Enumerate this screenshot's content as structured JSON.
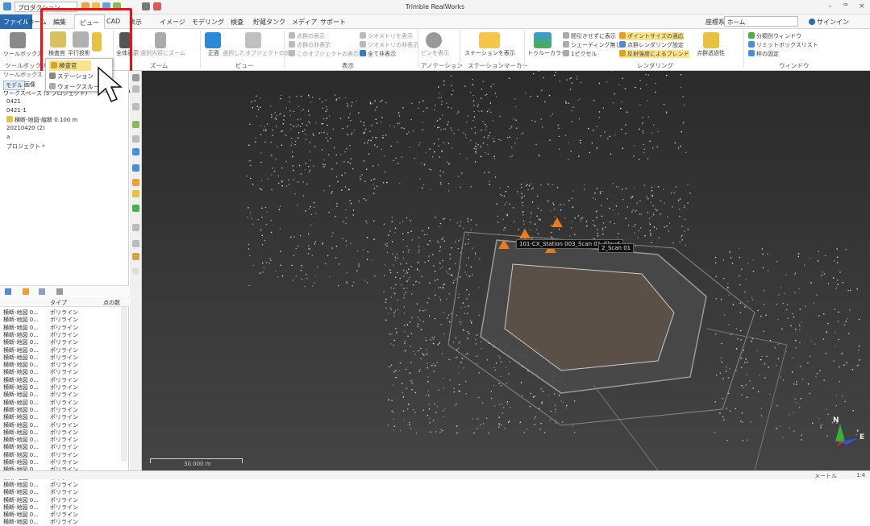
{
  "window": {
    "title": "Trimble RealWorks",
    "quick_select": "プロダクション",
    "controls": [
      "–",
      "ꟹ",
      "×"
    ]
  },
  "menu": {
    "tabs": [
      "ファイル",
      "ホーム",
      "編集",
      "ビュー",
      "CAD",
      "表示",
      "イメージ",
      "モデリング",
      "検査",
      "貯蔵タンク",
      "メディア",
      "サポート"
    ],
    "right_label": "座標系",
    "coord_value": "ホーム",
    "signin": "サインイン"
  },
  "ribbon": {
    "groups": {
      "toolbox": "ツールボックス",
      "zoom": "ズーム",
      "view": "ビュー",
      "display": "表示",
      "annotation": "アノテーション",
      "station_marker": "ステーションマーカー",
      "rendering": "レンダリング",
      "window": "ウィンドウ"
    },
    "toolbox_btn": "ツールボックス",
    "inspector_btn": "検査官",
    "parallel_btn": "平行投影",
    "zoom_all": "全体表示",
    "zoom_selected": "選択内容にズーム",
    "front_view": "正面",
    "selected_view": "選択したオブジェクトの前",
    "display_items": [
      "点群の表示",
      "点群の非表示",
      "このオブジェクトの表示",
      "ジオメトリを表示",
      "ジオメトリの非表示",
      "全て非表示"
    ],
    "pin_btn": "ピンを表示",
    "station_btn": "ステーションを表示",
    "tolerance_btn": "トゥルーカラー",
    "render_items": [
      "間引きせずに表示",
      "シェーディング無し",
      "1ピクセル",
      "ポイントサイズの適応",
      "点群レンダリング設定",
      "反射強度によるブレンド"
    ],
    "transparency_btn": "点群透過性",
    "window_items": [
      "分類別ウィンドウ",
      "リミットボックスリスト",
      "枠の固定"
    ]
  },
  "dropdown": {
    "items": [
      "検査官",
      "ステーション",
      "ウォークスルー"
    ]
  },
  "left_panel": {
    "header": "ツールボックス",
    "workspace_label": "ワークスペース",
    "tabs": [
      "モデル",
      "画像"
    ],
    "tree": [
      "ワークスペース (5 プロジェクト)",
      "0421",
      "0421-1",
      "横断-地図-縦断 0.100 m",
      "20210420 (2)",
      "a",
      "プロジェクト *"
    ],
    "table_headers": [
      "タイプ",
      "点の数"
    ],
    "rows": [
      {
        "name": "横断-地図 0...",
        "type": "ポリライン"
      },
      {
        "name": "横断-地図 0...",
        "type": "ポリライン"
      },
      {
        "name": "横断-地図 0...",
        "type": "ポリライン"
      },
      {
        "name": "横断-地図 0...",
        "type": "ポリライン"
      },
      {
        "name": "横断-地図 0...",
        "type": "ポリライン"
      },
      {
        "name": "横断-地図 0...",
        "type": "ポリライン"
      },
      {
        "name": "横断-地図 0...",
        "type": "ポリライン"
      },
      {
        "name": "横断-地図 0...",
        "type": "ポリライン"
      },
      {
        "name": "横断-地図 0...",
        "type": "ポリライン"
      },
      {
        "name": "横断-地図 0...",
        "type": "ポリライン"
      },
      {
        "name": "横断-地図 0...",
        "type": "ポリライン"
      },
      {
        "name": "横断-地図 0...",
        "type": "ポリライン"
      },
      {
        "name": "横断-地図 0...",
        "type": "ポリライン"
      },
      {
        "name": "横断-地図 0...",
        "type": "ポリライン"
      },
      {
        "name": "横断-地図 0...",
        "type": "ポリライン"
      },
      {
        "name": "横断-地図 0...",
        "type": "ポリライン"
      },
      {
        "name": "横断-地図 0...",
        "type": "ポリライン"
      },
      {
        "name": "横断-地図 0...",
        "type": "ポリライン"
      },
      {
        "name": "横断-地図 0...",
        "type": "ポリライン"
      },
      {
        "name": "横断-地図 0...",
        "type": "ポリライン"
      },
      {
        "name": "横断-地図 0...",
        "type": "ポリライン"
      },
      {
        "name": "横断-地図 0...",
        "type": "ポリライン"
      },
      {
        "name": "横断-地図 0...",
        "type": "ポリライン"
      },
      {
        "name": "横断-地図 0...",
        "type": "ポリライン"
      },
      {
        "name": "横断-地図 0...",
        "type": "ポリライン"
      },
      {
        "name": "横断-地図 0...",
        "type": "ポリライン"
      },
      {
        "name": "横断-地図 0...",
        "type": "ポリライン"
      },
      {
        "name": "横断-地図 0...",
        "type": "ポリライン"
      },
      {
        "name": "横断-地図 0...",
        "type": "ポリライン"
      }
    ]
  },
  "viewport": {
    "scan_label_1": "101-CX_Station 003_Scan 01_Cloud",
    "scan_label_2": "2_Scan 01",
    "scale_label": "30.000 m",
    "compass_n": "N",
    "compass_e": "E"
  },
  "status": {
    "unit": "メートル",
    "right": "1:4"
  },
  "colors": {
    "accent": "#2b6cb0",
    "highlight": "#e11111",
    "warn": "#e87c1e"
  }
}
